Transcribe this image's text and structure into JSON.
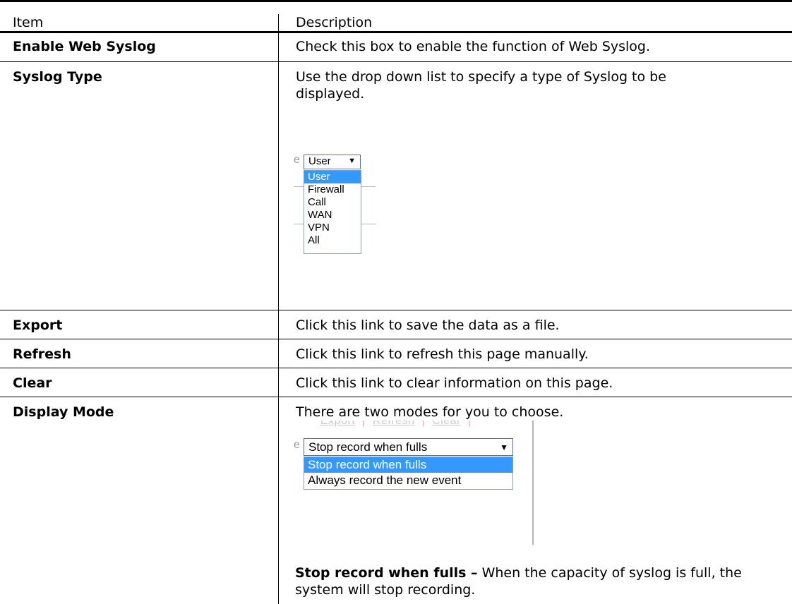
{
  "header": {
    "item": "Item",
    "description": "Description"
  },
  "rows": [
    {
      "item": "Enable Web Syslog",
      "description": "Check this box to enable the function of Web Syslog."
    },
    {
      "item": "Syslog Type",
      "description": "Use the drop down list to specify a type of Syslog to be displayed."
    },
    {
      "item": "Export",
      "description": "Click this link to save the data as a file."
    },
    {
      "item": "Refresh",
      "description": "Click this link to refresh this page manually."
    },
    {
      "item": "Clear",
      "description": "Click this link to clear information on this page."
    },
    {
      "item": "Display Mode",
      "description": "There are two modes for you to choose."
    }
  ],
  "syslog_type_inset": {
    "ghost_char": "e",
    "selected": "User",
    "arrow": "▼",
    "options": [
      "User",
      "Firewall",
      "Call",
      "WAN",
      "VPN",
      "All"
    ]
  },
  "display_mode_inset": {
    "links": [
      "Export",
      "Refresh",
      "Clear"
    ],
    "ghost_char": "e",
    "selected": "Stop record when fulls",
    "arrow": "▼",
    "options": [
      "Stop record when fulls",
      "Always record the new event"
    ],
    "note_bold": "Stop record when fulls –",
    "note_text": " When the capacity of syslog is full, the system will stop recording."
  },
  "colors": {
    "selection": "#3399ff",
    "select_border": "#4a6fb5"
  }
}
